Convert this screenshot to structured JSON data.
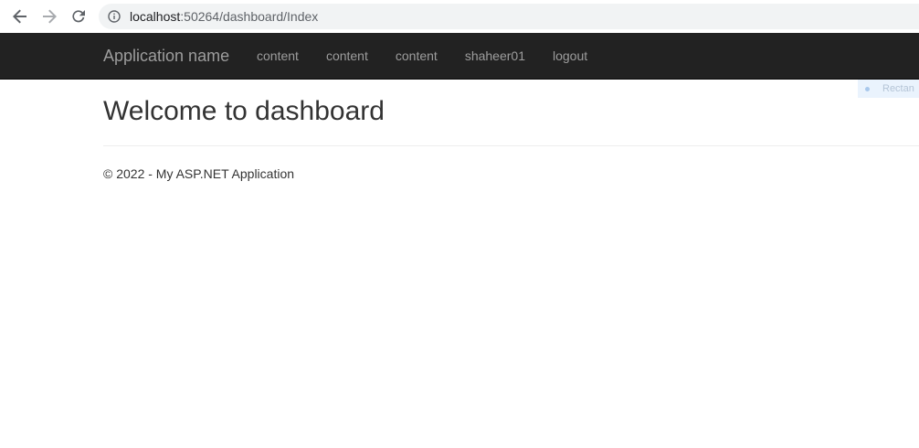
{
  "browser": {
    "url_host": "localhost",
    "url_path": ":50264/dashboard/Index"
  },
  "navbar": {
    "brand": "Application name",
    "links": [
      {
        "label": "content"
      },
      {
        "label": "content"
      },
      {
        "label": "content"
      },
      {
        "label": "shaheer01"
      },
      {
        "label": "logout"
      }
    ]
  },
  "overlay": {
    "text": "Rectan"
  },
  "main": {
    "title": "Welcome to dashboard"
  },
  "footer": {
    "text": "© 2022 - My ASP.NET Application"
  },
  "colors": {
    "navbar_bg": "#222222",
    "nav_text": "#9d9d9d",
    "body_text": "#333333",
    "omnibox_bg": "#f1f3f4"
  },
  "icons": {
    "back": "back-arrow-icon",
    "forward": "forward-arrow-icon",
    "reload": "reload-icon",
    "info": "info-icon"
  }
}
